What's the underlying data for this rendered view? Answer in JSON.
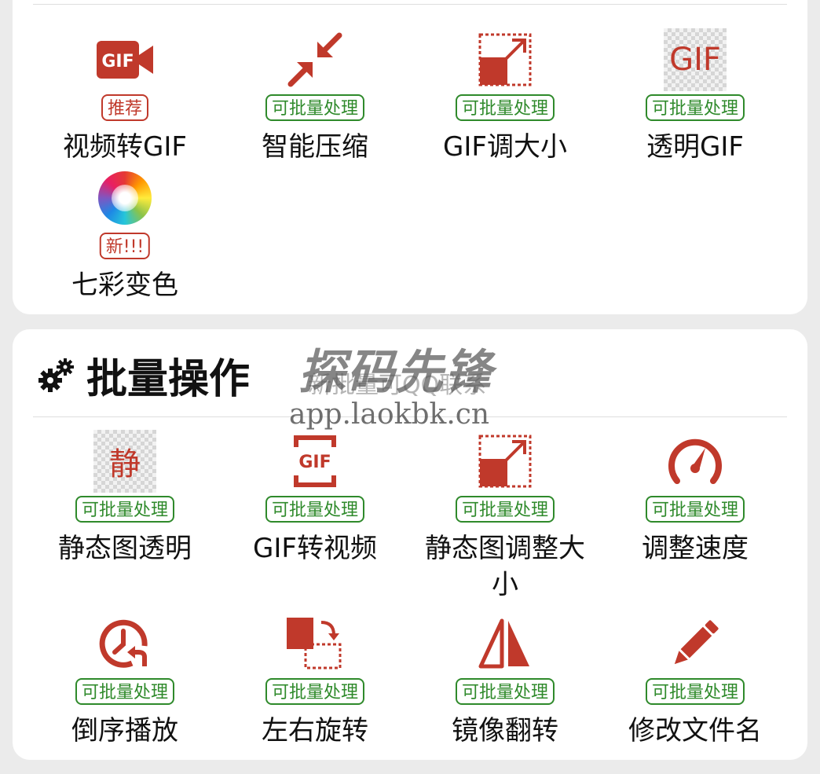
{
  "colors": {
    "accent_red": "#c0392b",
    "badge_green": "#2f8a2b",
    "background": "#ebebeb"
  },
  "top_section": {
    "tools": [
      {
        "label": "视频转GIF",
        "badge": "推荐",
        "badge_style": "red",
        "icon": "video-gif-icon"
      },
      {
        "label": "智能压缩",
        "badge": "可批量处理",
        "badge_style": "green",
        "icon": "compress-arrows-icon"
      },
      {
        "label": "GIF调大小",
        "badge": "可批量处理",
        "badge_style": "green",
        "icon": "resize-icon"
      },
      {
        "label": "透明GIF",
        "badge": "可批量处理",
        "badge_style": "green",
        "icon": "transparent-gif-icon",
        "icon_text": "GIF"
      },
      {
        "label": "七彩变色",
        "badge": "新!!!",
        "badge_style": "red",
        "icon": "color-wheel-icon"
      }
    ]
  },
  "batch_section": {
    "title": "批量操作",
    "icon": "gears-icon",
    "tools": [
      {
        "label": "静态图透明",
        "badge": "可批量处理",
        "icon": "static-transparent-icon",
        "icon_text": "静"
      },
      {
        "label": "GIF转视频",
        "badge": "可批量处理",
        "icon": "gif-to-video-icon",
        "icon_text": "GIF"
      },
      {
        "label": "静态图调整大小",
        "badge": "可批量处理",
        "icon": "static-resize-icon"
      },
      {
        "label": "调整速度",
        "badge": "可批量处理",
        "icon": "speedometer-icon"
      },
      {
        "label": "倒序播放",
        "badge": "可批量处理",
        "icon": "reverse-clock-icon"
      },
      {
        "label": "左右旋转",
        "badge": "可批量处理",
        "icon": "rotate-icon"
      },
      {
        "label": "镜像翻转",
        "badge": "可批量处理",
        "icon": "mirror-flip-icon"
      },
      {
        "label": "修改文件名",
        "badge": "可批量处理",
        "icon": "pencil-icon"
      }
    ]
  },
  "watermark": {
    "brand": "探码先锋",
    "overlay": "新批量可QQ联系",
    "url": "app.laokbk.cn"
  }
}
